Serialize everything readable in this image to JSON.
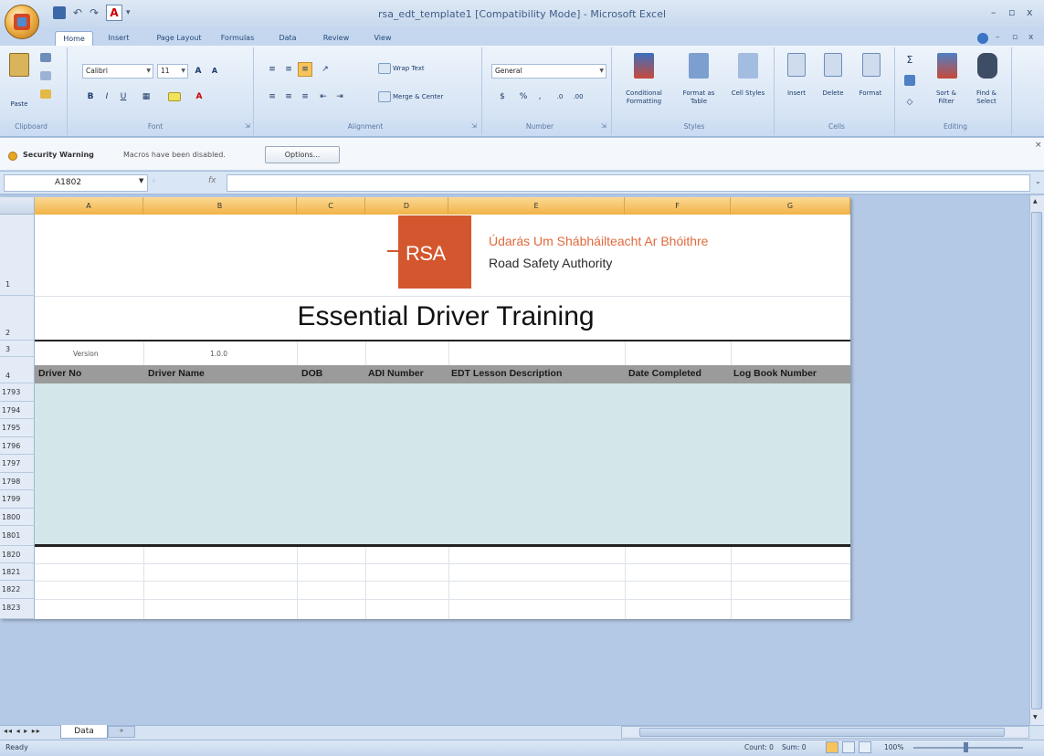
{
  "window": {
    "title": "rsa_edt_template1  [Compatibility Mode] - Microsoft Excel",
    "controls": [
      "–",
      "▫",
      "x"
    ],
    "inner_controls": [
      "–",
      "▫",
      "x"
    ]
  },
  "ribbon_tabs": [
    "Home",
    "Insert",
    "Page Layout",
    "Formulas",
    "Data",
    "Review",
    "View"
  ],
  "ribbon": {
    "clipboard": {
      "paste": "Paste",
      "label": "Clipboard"
    },
    "font": {
      "name": "Calibri",
      "size": "11",
      "label": "Font"
    },
    "alignment": {
      "wrap": "Wrap Text",
      "merge": "Merge & Center",
      "label": "Alignment"
    },
    "number": {
      "format": "General",
      "label": "Number"
    },
    "styles": {
      "conditional": "Conditional Formatting",
      "format_table": "Format as Table",
      "cell_styles": "Cell Styles",
      "label": "Styles"
    },
    "cells": {
      "insert": "Insert",
      "delete": "Delete",
      "format": "Format",
      "label": "Cells"
    },
    "editing": {
      "sort": "Sort & Filter",
      "find": "Find & Select",
      "label": "Editing"
    }
  },
  "security": {
    "title": "Security Warning",
    "message": "Macros have been disabled.",
    "options": "Options..."
  },
  "formula_bar": {
    "name_box": "A1802",
    "fx": "fx",
    "value": ""
  },
  "columns": [
    "A",
    "B",
    "C",
    "D",
    "E",
    "F",
    "G"
  ],
  "rows": {
    "top": [
      "1",
      "2",
      "3",
      "4"
    ],
    "data": [
      "1793",
      "1794",
      "1795",
      "1796",
      "1797",
      "1798",
      "1799",
      "1800",
      "1801"
    ],
    "bottom": [
      "1820",
      "1821",
      "1822",
      "1823"
    ]
  },
  "header_logo": {
    "mark": "RSA",
    "org_irish": "Údarás Um Shábháilteacht Ar Bhóithre",
    "org_english": "Road Safety Authority"
  },
  "title": "Essential Driver Training",
  "version": {
    "label": "Version",
    "value": "1.0.0"
  },
  "table_headers": [
    "Driver No",
    "Driver Name",
    "DOB",
    "ADI Number",
    "EDT Lesson Description",
    "Date Completed",
    "Log Book Number"
  ],
  "sheet_tabs": {
    "nav": "◂◂ ◂ ▸ ▸▸",
    "active": "Data"
  },
  "status": {
    "ready": "Ready",
    "count": "Count: 0",
    "sum": "Sum: 0",
    "zoom": "100%"
  }
}
